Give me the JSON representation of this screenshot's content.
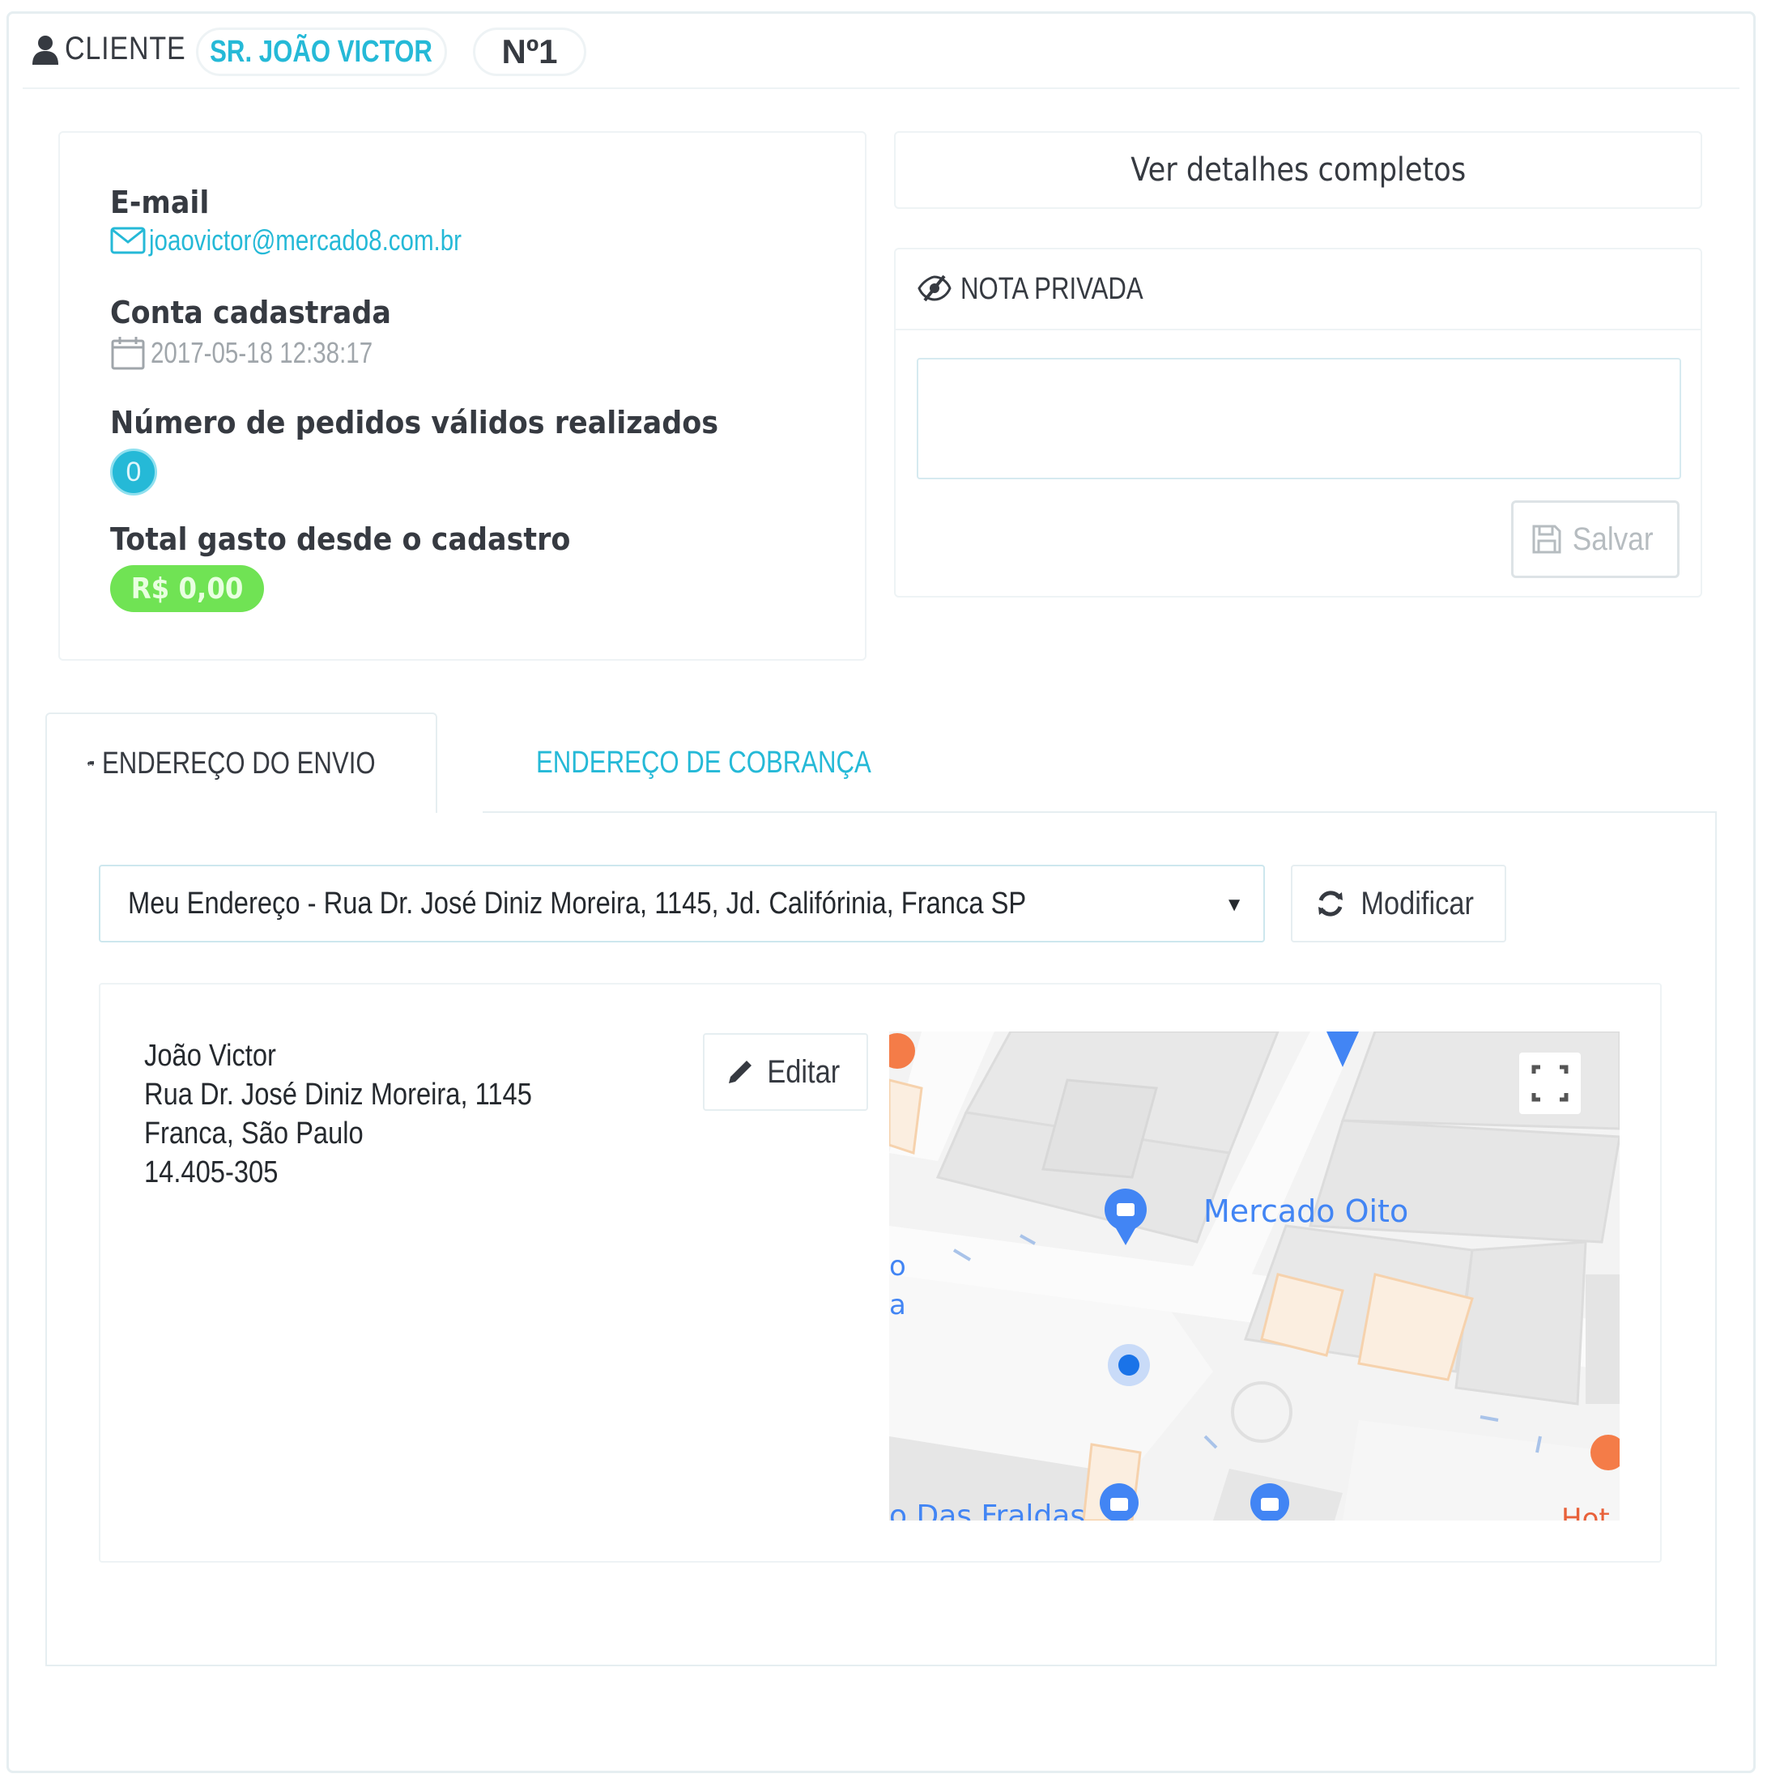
{
  "header": {
    "title": "CLIENTE",
    "customer_name": "SR. JOÃO VICTOR",
    "customer_number": "Nº1"
  },
  "info": {
    "email_label": "E-mail",
    "email_value": "joaovictor@mercado8.com.br",
    "registered_label": "Conta cadastrada",
    "registered_value": "2017-05-18 12:38:17",
    "orders_label": "Número de pedidos válidos realizados",
    "orders_value": "0",
    "spent_label": "Total gasto desde o cadastro",
    "spent_value": "R$ 0,00"
  },
  "details_button": "Ver detalhes completos",
  "private_note": {
    "title": "NOTA PRIVADA",
    "text": "",
    "save_label": "Salvar"
  },
  "tabs": [
    {
      "label": "ENDEREÇO DO ENVIO",
      "active": true
    },
    {
      "label": "ENDEREÇO DE COBRANÇA",
      "active": false
    }
  ],
  "address_select": {
    "selected": "Meu Endereço  - Rua Dr. José Diniz Moreira, 1145, Jd. Califórinia, Franca SP"
  },
  "modify_button": "Modificar",
  "address": {
    "name": "João Victor",
    "street": "Rua Dr. José Diniz Moreira, 1145",
    "city": "Franca, São Paulo",
    "zip": "14.405-305",
    "edit_label": "Editar"
  },
  "map": {
    "place_main": "Mercado Oito",
    "place_bottom": "o Das Fraldas",
    "left_edge_1": "o",
    "left_edge_2": "a",
    "right_edge": "Hot"
  },
  "colors": {
    "accent": "#25b9d7",
    "success": "#70e354",
    "text": "#363a41",
    "muted": "#a0a6ab"
  }
}
